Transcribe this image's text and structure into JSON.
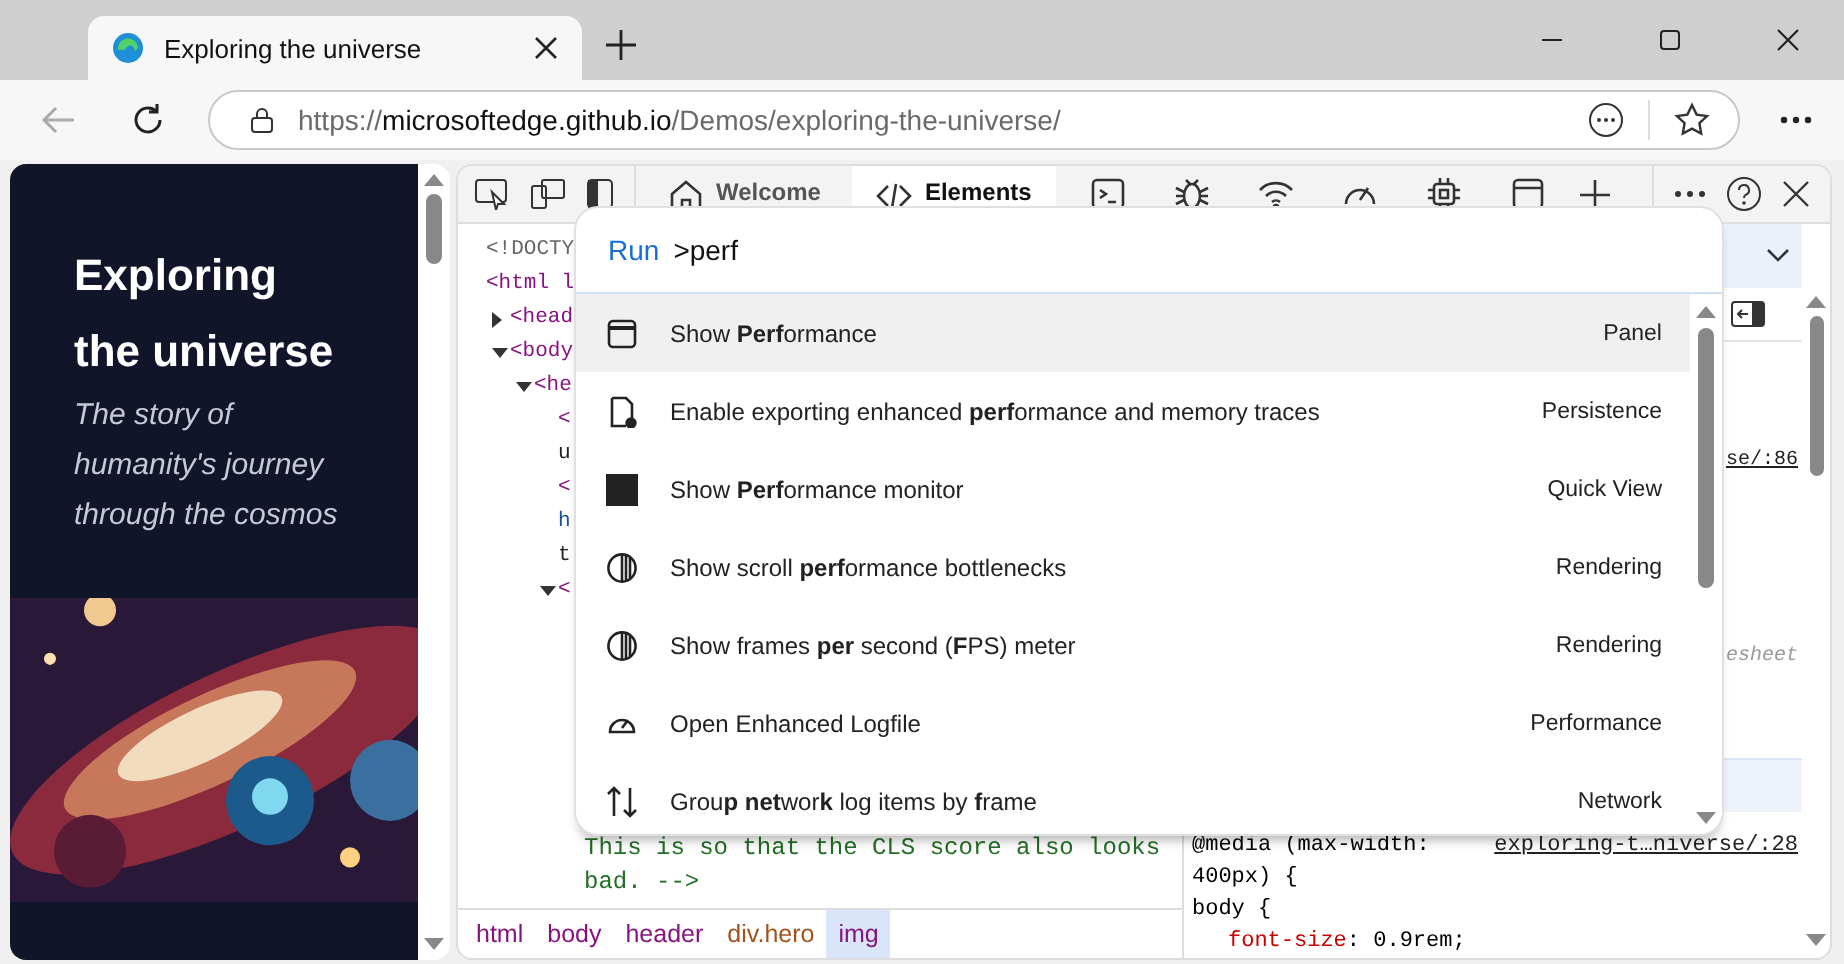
{
  "browser": {
    "tab": {
      "title": "Exploring the universe"
    },
    "address": {
      "scheme": "https://",
      "host": "microsoftedge.github.io",
      "path": "/Demos/exploring-the-universe/"
    }
  },
  "page": {
    "heading": "Exploring the universe",
    "subtitle": "The story of humanity's journey through the cosmos"
  },
  "devtools": {
    "tabs": [
      {
        "label": "Welcome",
        "selected": false
      },
      {
        "label": "Elements",
        "selected": true
      },
      {
        "selected": false
      },
      {
        "selected": false
      },
      {
        "selected": false
      },
      {
        "selected": false
      },
      {
        "selected": false
      },
      {
        "selected": false
      }
    ],
    "dom_top": [
      {
        "text": "<!DOCTY",
        "kind": "doctype"
      },
      {
        "text": "<html l",
        "kind": "tag",
        "children": [
          {
            "text": "<head",
            "kind": "tag",
            "expanded": false
          },
          {
            "text": "<body",
            "kind": "tag",
            "expanded": true,
            "children": [
              {
                "text": "<he",
                "kind": "tag",
                "expanded": true,
                "children": [
                  {
                    "text": "<",
                    "kind": "tag"
                  },
                  {
                    "text": "u",
                    "kind": "text"
                  },
                  {
                    "text": "<",
                    "kind": "tag"
                  },
                  {
                    "text": "h",
                    "kind": "attr"
                  },
                  {
                    "text": "t",
                    "kind": "text"
                  },
                  {
                    "text": "<",
                    "kind": "tag",
                    "expanded": true
                  }
                ]
              }
            ]
          }
        ]
      }
    ],
    "dom_bottom": [
      {
        "text": "This is so that the CLS score also looks",
        "kind": "comment"
      },
      {
        "text": "bad. -->",
        "kind": "comment"
      }
    ],
    "breadcrumbs": [
      {
        "label": "html",
        "kind": "tag",
        "selected": false
      },
      {
        "label": "body",
        "kind": "tag",
        "selected": false
      },
      {
        "label": "header",
        "kind": "tag",
        "selected": false
      },
      {
        "label": "div.hero",
        "kind": "class",
        "selected": false
      },
      {
        "label": "img",
        "kind": "tag",
        "selected": true
      }
    ],
    "styles": {
      "source_1": "se/:86",
      "source_2": "esheet",
      "media": "@media (max-width:",
      "media_source": "exploring-t…niverse/:28",
      "media_cont": "400px) {",
      "selector": "body {",
      "property": "font-size",
      "value": ": 0.9rem;"
    },
    "command_palette": {
      "prefix": "Run",
      "query": ">perf",
      "items": [
        {
          "title": "Show **Perf**ormance",
          "category": "Panel",
          "selected": true
        },
        {
          "title": "Enable exporting enhanced **perf**ormance and memory traces",
          "category": "Persistence",
          "selected": false
        },
        {
          "title": "Show **Perf**ormance monitor",
          "category": "Quick View",
          "selected": false
        },
        {
          "title": "Show scroll **perf**ormance bottlenecks",
          "category": "Rendering",
          "selected": false
        },
        {
          "title": "Show frames **per** second (**F**PS) meter",
          "category": "Rendering",
          "selected": false
        },
        {
          "title": "Open Enhanced Logfile",
          "category": "Performance",
          "selected": false
        },
        {
          "title": "Grou**p** **net**wor**k** log items by **f**rame",
          "category": "Network",
          "selected": false
        }
      ]
    }
  }
}
